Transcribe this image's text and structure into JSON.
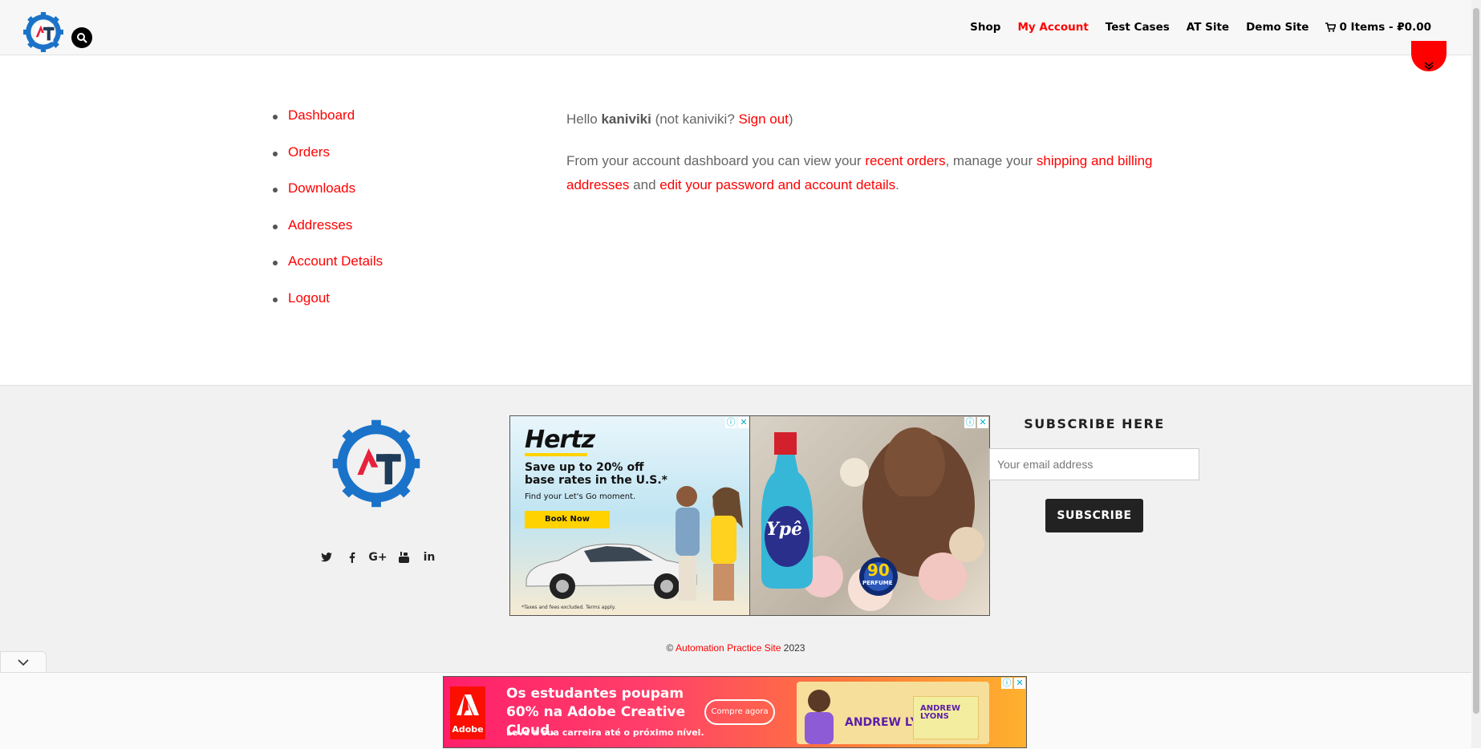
{
  "header": {
    "nav": [
      "Shop",
      "My Account",
      "Test Cases",
      "AT Site",
      "Demo Site"
    ],
    "active_nav": "My Account",
    "cart_label": "0 Items - ₽0.00"
  },
  "account_nav": [
    "Dashboard",
    "Orders",
    "Downloads",
    "Addresses",
    "Account Details",
    "Logout"
  ],
  "greeting": {
    "hello": "Hello ",
    "username": "kaniviki",
    "not_prefix": " (not kaniviki? ",
    "sign_out": "Sign out",
    "close": ")"
  },
  "dashboard_text": {
    "intro": "From your account dashboard you can view your ",
    "recent_orders": "recent orders",
    "mid": ", manage your ",
    "addresses": "shipping and billing addresses",
    "and": " and ",
    "edit": "edit your password and account details",
    "end": "."
  },
  "footer": {
    "subscribe_title": "SUBSCRIBE HERE",
    "email_placeholder": "Your email address",
    "subscribe_button": "SUBSCRIBE",
    "copyright_symbol": "©",
    "copyright_link": "Automation Practice Site",
    "copyright_year": "2023",
    "social": [
      "twitter-icon",
      "facebook-icon",
      "google-plus-icon",
      "youtube-icon",
      "linkedin-icon"
    ]
  },
  "ads": {
    "hertz": {
      "brand": "Hertz",
      "headline": "Save up to 20% off base rates in the U.S.*",
      "sub": "Find your Let's Go moment.",
      "button": "Book Now",
      "fine": "*Taxes and fees excluded. Terms apply."
    },
    "ype": {
      "brand": "Ypê",
      "badge_number": "90",
      "badge_text": "PERFUME"
    },
    "adobe": {
      "logo": "Adobe",
      "headline": "Os estudantes poupam 60% na Adobe Creative Cloud.",
      "sub": "Leve a sua carreira até o próximo nível.",
      "button": "Compre agora",
      "person_name": "ANDREW LYONS",
      "person_name_small": "ANDREW LYONS"
    }
  },
  "colors": {
    "accent": "#ff0000",
    "header_bg": "#f7f7f7",
    "footer_bg": "#f1f1f1",
    "logo_blue": "#1a73c9",
    "logo_navy": "#1f3b5a"
  }
}
